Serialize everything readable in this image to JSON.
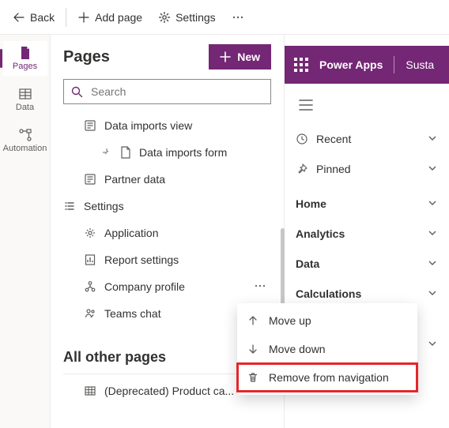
{
  "toolbar": {
    "back": "Back",
    "add_page": "Add page",
    "settings": "Settings"
  },
  "rail": {
    "pages": "Pages",
    "data": "Data",
    "automation": "Automation"
  },
  "panel": {
    "title": "Pages",
    "new_label": "New",
    "search_placeholder": "Search",
    "items": {
      "data_imports_view": "Data imports view",
      "data_imports_form": "Data imports form",
      "partner_data": "Partner data",
      "settings_group": "Settings",
      "application": "Application",
      "report_settings": "Report settings",
      "company_profile": "Company profile",
      "teams_chat": "Teams chat"
    },
    "other_title": "All other pages",
    "other_item": "(Deprecated) Product ca..."
  },
  "preview": {
    "app_name": "Power Apps",
    "env": "Susta",
    "nav": {
      "recent": "Recent",
      "pinned": "Pinned",
      "home": "Home",
      "analytics": "Analytics",
      "data": "Data",
      "calculations": "Calculations"
    }
  },
  "context_menu": {
    "move_up": "Move up",
    "move_down": "Move down",
    "remove": "Remove from navigation"
  }
}
